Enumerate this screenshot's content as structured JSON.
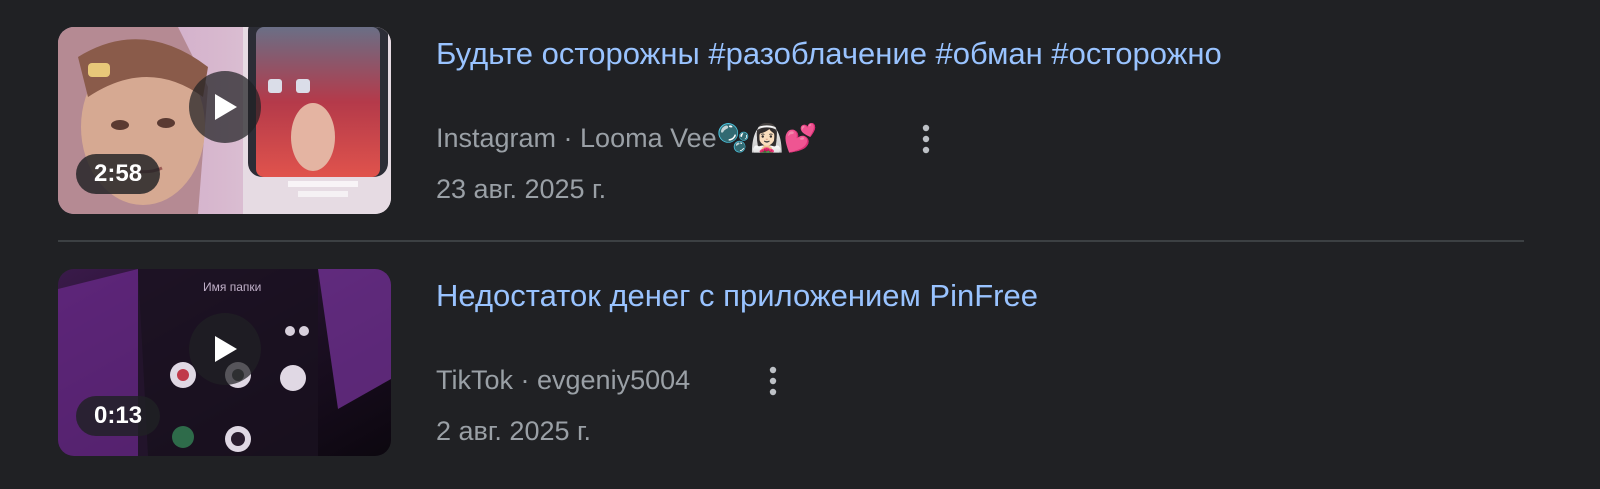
{
  "results": [
    {
      "title": "Будьте осторожны #разоблачение #обман #осторожно",
      "source": "Instagram · Looma Vee🫧👰🏻‍♀️💕",
      "date": "23 авг. 2025 г.",
      "duration": "2:58"
    },
    {
      "title": "Недостаток денег с приложением PinFree",
      "source": "TikTok · evgeniy5004",
      "date": "2 авг. 2025 г.",
      "duration": "0:13",
      "thumbnail_text": "Имя папки"
    }
  ],
  "icons": {
    "play": "play-icon",
    "more": "more-vert-icon"
  },
  "colors": {
    "background": "#202124",
    "title_link": "#99c3ff",
    "meta_text": "#9aa0a6",
    "divider": "#3c4043"
  }
}
